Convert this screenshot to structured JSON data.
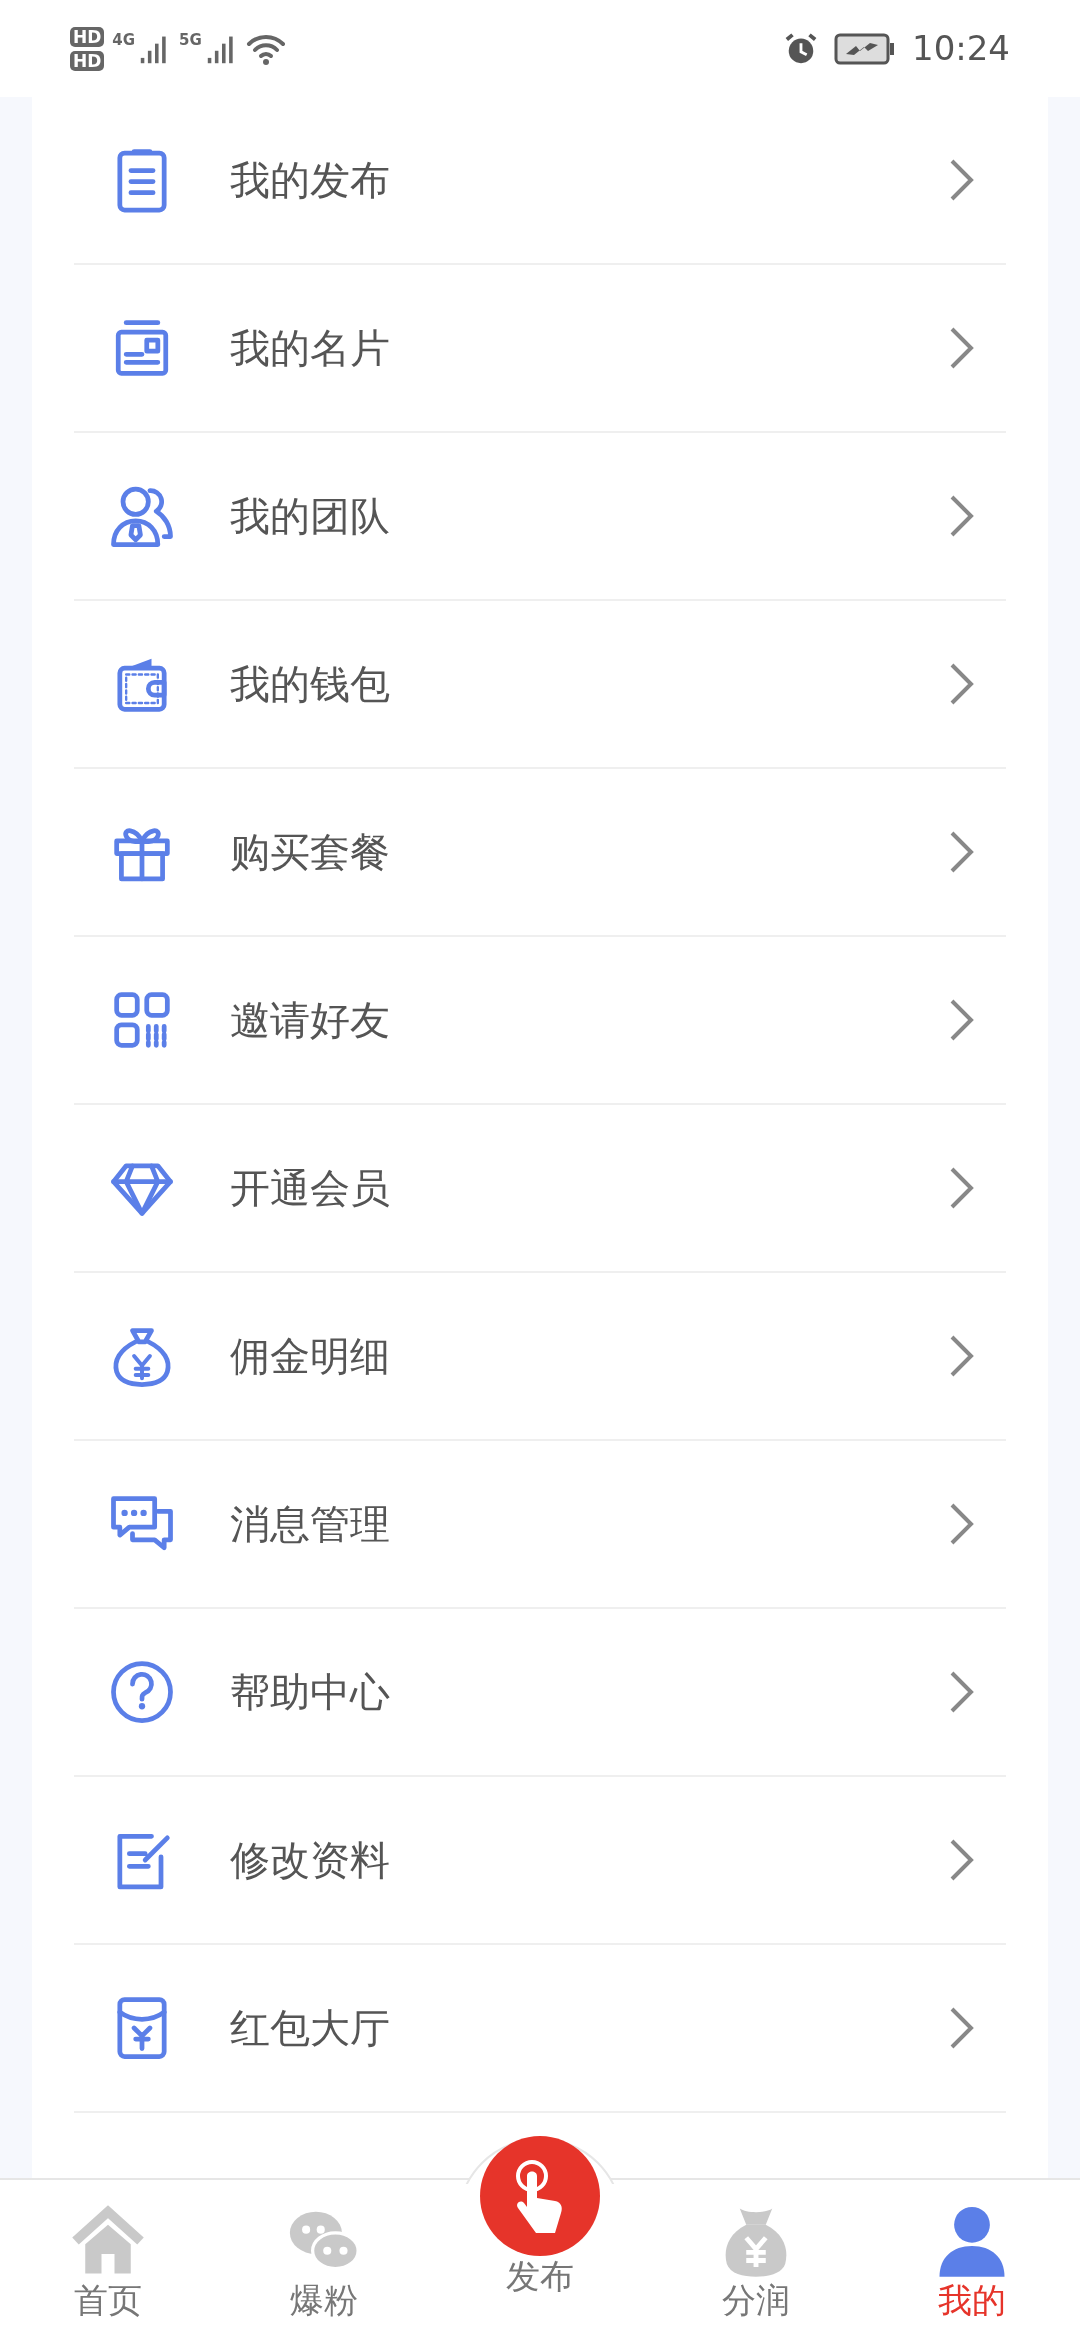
{
  "status_bar": {
    "sim_labels": [
      "HD",
      "HD"
    ],
    "network_labels": [
      "4G",
      "5G"
    ],
    "time": "10:24"
  },
  "menu": [
    {
      "label": "我的发布"
    },
    {
      "label": "我的名片"
    },
    {
      "label": "我的团队"
    },
    {
      "label": "我的钱包"
    },
    {
      "label": "购买套餐"
    },
    {
      "label": "邀请好友"
    },
    {
      "label": "开通会员"
    },
    {
      "label": "佣金明细"
    },
    {
      "label": "消息管理"
    },
    {
      "label": "帮助中心"
    },
    {
      "label": "修改资料"
    },
    {
      "label": "红包大厅"
    }
  ],
  "bottom_nav": [
    {
      "label": "首页",
      "kind": "tab",
      "selected": false
    },
    {
      "label": "爆粉",
      "kind": "tab",
      "selected": false
    },
    {
      "label": "发布",
      "kind": "fab",
      "selected": false
    },
    {
      "label": "分润",
      "kind": "tab",
      "selected": false
    },
    {
      "label": "我的",
      "kind": "tab",
      "selected": true
    }
  ]
}
